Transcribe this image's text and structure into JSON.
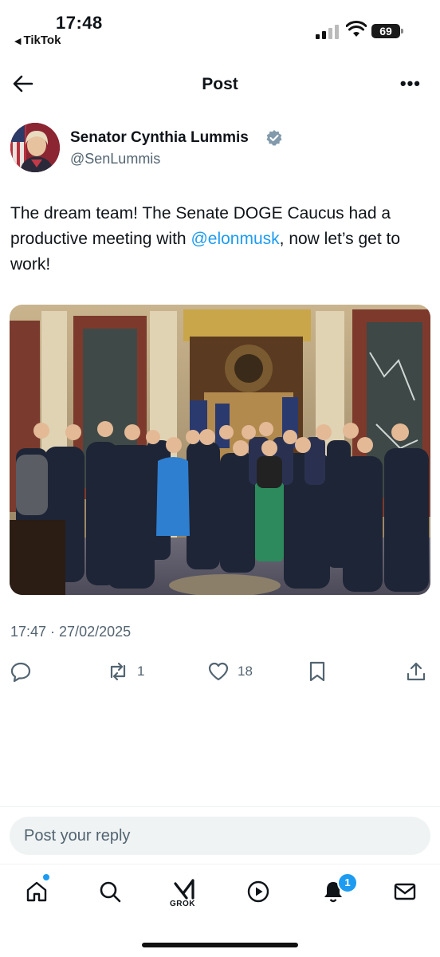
{
  "status_bar": {
    "time": "17:48",
    "back_app": "TikTok",
    "battery": "69"
  },
  "header": {
    "title": "Post"
  },
  "post": {
    "author_name": "Senator Cynthia Lummis",
    "handle": "@SenLummis",
    "text_before": "The dream team! The Senate DOGE Caucus had a productive meeting with ",
    "mention": "@elonmusk",
    "text_after": ", now let’s get to work!",
    "timestamp": "17:47 · 27/02/2025",
    "reposts": "1",
    "likes": "18"
  },
  "reply": {
    "placeholder": "Post your reply"
  },
  "tabbar": {
    "grok_label": "GROK",
    "notification_count": "1"
  },
  "icons": [
    "back-arrow-icon",
    "more-icon",
    "verified-badge-icon",
    "reply-icon",
    "repost-icon",
    "like-icon",
    "bookmark-icon",
    "share-icon",
    "home-icon",
    "search-icon",
    "grok-icon",
    "video-icon",
    "notifications-icon",
    "messages-icon"
  ],
  "colors": {
    "accent": "#1d9bf0",
    "muted_text": "#536471",
    "text": "#0f1419"
  }
}
